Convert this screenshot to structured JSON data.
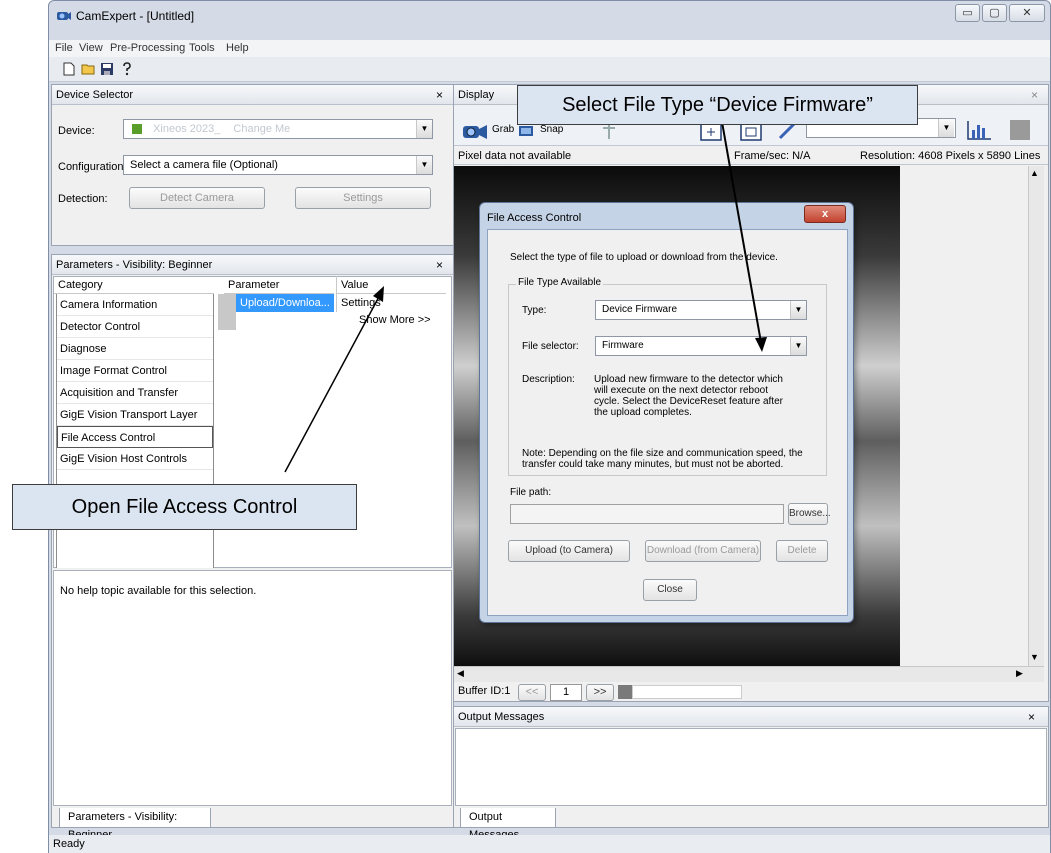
{
  "app": {
    "title": "CamExpert - [Untitled]"
  },
  "window_buttons": {
    "minimize": "▭",
    "maximize": "▢",
    "close": "✕"
  },
  "menu": {
    "items": [
      "File",
      "View",
      "Pre-Processing",
      "Tools",
      "Help"
    ]
  },
  "toolbar": {
    "icons": [
      "new-icon",
      "open-icon",
      "save-icon",
      "help-icon"
    ]
  },
  "device_selector": {
    "title": "Device Selector",
    "close": "×",
    "device_label": "Device:",
    "device_value": "Xineos 2023_",
    "device_change": "Change Me",
    "configuration_label": "Configuration:",
    "configuration_value": "Select a camera file (Optional)",
    "detection_label": "Detection:",
    "detect_button": "Detect Camera",
    "settings_button": "Settings"
  },
  "parameters": {
    "title": "Parameters - Visibility: Beginner",
    "close": "×",
    "col_category": "Category",
    "col_parameter": "Parameter",
    "col_value": "Value",
    "categories": [
      "Camera Information",
      "Detector Control",
      "Diagnose",
      "Image Format Control",
      "Acquisition and Transfer Cont...",
      "GigE Vision Transport Layer",
      "File Access Control",
      "GigE Vision Host Controls"
    ],
    "row_parameter": "Upload/Downloa...",
    "row_value": "Settings",
    "show_more": "Show More >>",
    "help_text": "No help topic available for this selection.",
    "tab": "Parameters - Visibility: Beginner"
  },
  "display": {
    "title": "Display",
    "close": "×",
    "grab_label": "Grab",
    "snap_label": "Snap",
    "pixel_data": "Pixel data not available",
    "frame_sec": "Frame/sec: N/A",
    "resolution": "Resolution: 4608 Pixels x 5890 Lines",
    "buffer_id": "Buffer ID:1",
    "buffer_prev": "<<",
    "buffer_num": "1",
    "buffer_next": ">>"
  },
  "dialog": {
    "title": "File Access Control",
    "close": "x",
    "intro": "Select the type of file to upload or download from the device.",
    "group_label": "File Type Available",
    "type_label": "Type:",
    "type_value": "Device Firmware",
    "selector_label": "File selector:",
    "selector_value": "Firmware",
    "description_label": "Description:",
    "description_text": "Upload new firmware to the detector which will execute on the next detector reboot cycle. Select the DeviceReset feature after the upload completes.",
    "note": "Note: Depending on the file size and communication speed, the transfer could take many minutes, but must not be aborted.",
    "file_path_label": "File path:",
    "file_path_value": "",
    "browse": "Browse...",
    "upload": "Upload (to Camera)",
    "download": "Download (from Camera)",
    "delete": "Delete",
    "close_button": "Close"
  },
  "output": {
    "title": "Output Messages",
    "close": "×",
    "tab": "Output Messages"
  },
  "status": {
    "text": "Ready"
  },
  "callouts": {
    "file_type": "Select File Type “Device Firmware”",
    "open_fac": "Open File Access Control"
  },
  "colors": {
    "selected_row": "#3399ff",
    "callout_fill": "#dbe4f1",
    "display_bg": "#1a1a1a"
  }
}
